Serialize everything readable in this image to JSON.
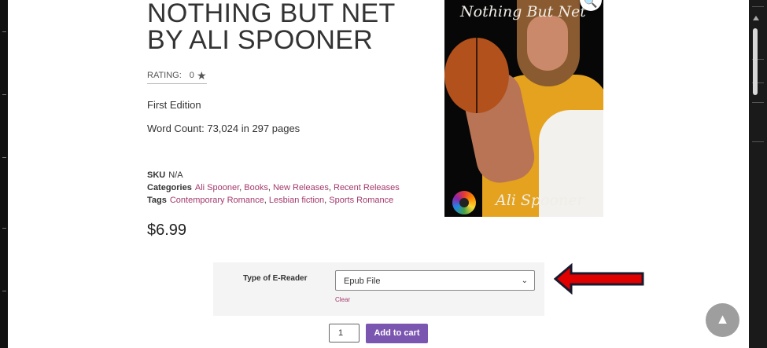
{
  "product": {
    "title_line1": "NOTHING BUT NET",
    "title_line2": "BY ALI SPOONER",
    "rating_label": "RATING:",
    "rating_value": "0",
    "edition": "First Edition",
    "word_count": "Word Count: 73,024 in 297 pages",
    "sku_label": "SKU",
    "sku_value": "N/A",
    "categories_label": "Categories",
    "categories": [
      "Ali Spooner",
      "Books",
      "New Releases",
      "Recent Releases"
    ],
    "tags_label": "Tags",
    "tags": [
      "Contemporary Romance",
      "Lesbian fiction",
      "Sports Romance"
    ],
    "price": "$6.99"
  },
  "cover": {
    "title": "Nothing But Net",
    "author": "Ali Spooner"
  },
  "variations": {
    "label": "Type of E-Reader",
    "selected": "Epub File",
    "clear_label": "Clear"
  },
  "cart": {
    "quantity": "1",
    "add_label": "Add to cart"
  },
  "icons": {
    "star": "star-icon",
    "zoom": "zoom-icon",
    "chevron": "chevron-down-icon",
    "scroll_top": "chevron-up-icon",
    "arrow": "red-arrow-annotation"
  },
  "colors": {
    "link": "#a3386b",
    "button": "#7b56b0",
    "arrow": "#e00000"
  }
}
